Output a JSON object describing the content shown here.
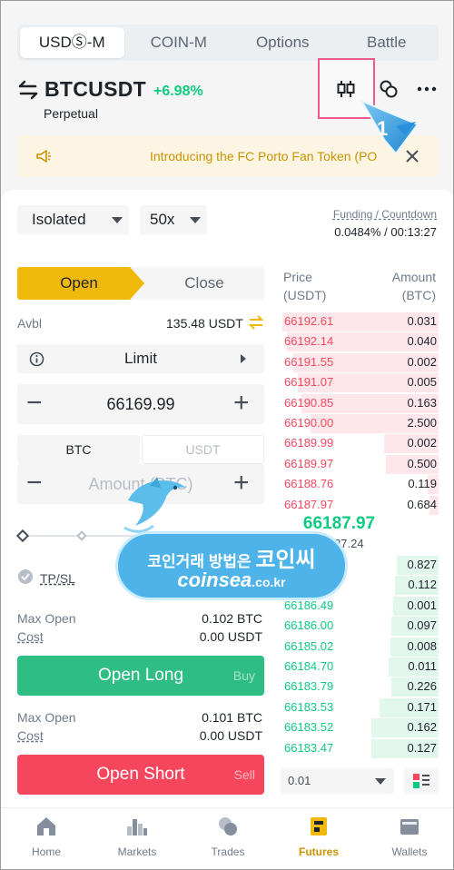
{
  "top_tabs": [
    "USDⓈ-M",
    "COIN-M",
    "Options",
    "Battle"
  ],
  "header": {
    "symbol": "BTCUSDT",
    "change": "+6.98%",
    "contract_type": "Perpetual",
    "callout_number": "1"
  },
  "banner": {
    "text": "Introducing the FC Porto Fan Token (PO"
  },
  "controls": {
    "margin_mode": "Isolated",
    "leverage": "50x",
    "funding_label": "Funding / Countdown",
    "funding_value": "0.0484% / 00:13:27"
  },
  "order_form": {
    "open_label": "Open",
    "close_label": "Close",
    "avbl_label": "Avbl",
    "avbl_value": "135.48 USDT",
    "order_type": "Limit",
    "price": "66169.99",
    "unit_btc": "BTC",
    "unit_usdt": "USDT",
    "amount_placeholder": "Amount (BTC)",
    "tpsl_label": "TP/SL",
    "long_max_open_label": "Max Open",
    "long_max_open_value": "0.102 BTC",
    "long_cost_label": "Cost",
    "long_cost_value": "0.00 USDT",
    "open_long": "Open Long",
    "buy": "Buy",
    "short_max_open_label": "Max Open",
    "short_max_open_value": "0.101 BTC",
    "short_cost_label": "Cost",
    "short_cost_value": "0.00 USDT",
    "open_short": "Open Short",
    "sell": "Sell"
  },
  "order_book": {
    "price_header": "Price\n(USDT)",
    "amount_header": "Amount\n(BTC)",
    "price_header_1": "Price",
    "price_header_2": "(USDT)",
    "amount_header_1": "Amount",
    "amount_header_2": "(BTC)",
    "asks": [
      {
        "price": "66192.61",
        "amount": "0.031",
        "depth": 1.0
      },
      {
        "price": "66192.14",
        "amount": "0.040",
        "depth": 0.97
      },
      {
        "price": "66191.55",
        "amount": "0.002",
        "depth": 0.93
      },
      {
        "price": "66191.07",
        "amount": "0.005",
        "depth": 0.9
      },
      {
        "price": "66190.85",
        "amount": "0.163",
        "depth": 0.88
      },
      {
        "price": "66190.00",
        "amount": "2.500",
        "depth": 0.82
      },
      {
        "price": "66189.99",
        "amount": "0.002",
        "depth": 0.35
      },
      {
        "price": "66189.97",
        "amount": "0.500",
        "depth": 0.34
      },
      {
        "price": "66188.76",
        "amount": "0.119",
        "depth": 0.07
      },
      {
        "price": "66187.97",
        "amount": "0.684",
        "depth": 0.06
      }
    ],
    "last_price": "66187.97",
    "mark_price": "66187.24",
    "bids": [
      {
        "price": "66186.74",
        "amount": "0.827",
        "depth": 0.27
      },
      {
        "price": "66186.74",
        "amount": "0.112",
        "depth": 0.28
      },
      {
        "price": "66186.49",
        "amount": "0.001",
        "depth": 0.29
      },
      {
        "price": "66186.00",
        "amount": "0.097",
        "depth": 0.3
      },
      {
        "price": "66185.02",
        "amount": "0.008",
        "depth": 0.31
      },
      {
        "price": "66184.70",
        "amount": "0.011",
        "depth": 0.32
      },
      {
        "price": "66183.79",
        "amount": "0.226",
        "depth": 0.3
      },
      {
        "price": "66183.53",
        "amount": "0.171",
        "depth": 0.38
      },
      {
        "price": "66183.52",
        "amount": "0.162",
        "depth": 0.43
      },
      {
        "price": "66183.47",
        "amount": "0.127",
        "depth": 0.43
      }
    ],
    "precision": "0.01"
  },
  "bottom_nav": [
    {
      "label": "Home",
      "icon": "home-icon"
    },
    {
      "label": "Markets",
      "icon": "markets-icon"
    },
    {
      "label": "Trades",
      "icon": "trades-icon"
    },
    {
      "label": "Futures",
      "icon": "futures-icon",
      "active": true
    },
    {
      "label": "Wallets",
      "icon": "wallet-icon"
    }
  ],
  "watermark": {
    "line1_small": "코인거래 방법은",
    "line1_big": "코인씨",
    "line2_main": "coinsea",
    "line2_suffix": ".co.kr"
  },
  "colors": {
    "accent": "#f0b90b",
    "buy": "#0ecb81",
    "sell": "#f6465d",
    "long_button": "#2ebd85",
    "short_button": "#f6465d"
  }
}
